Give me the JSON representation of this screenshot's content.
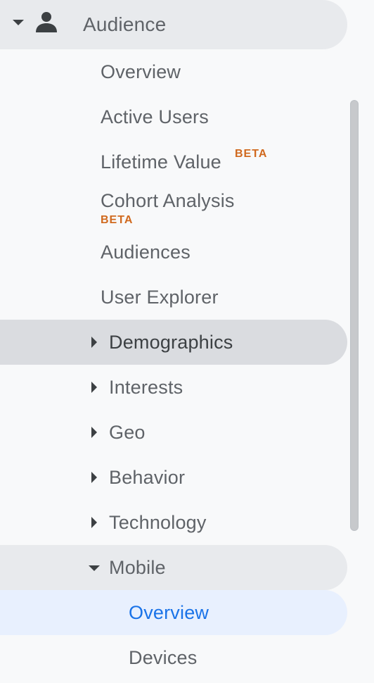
{
  "audience": {
    "label": "Audience",
    "icon": "person-icon"
  },
  "items": {
    "overview": "Overview",
    "active_users": "Active Users",
    "lifetime_value": "Lifetime Value",
    "lifetime_value_badge": "BETA",
    "cohort_analysis": "Cohort Analysis",
    "cohort_analysis_badge": "BETA",
    "audiences": "Audiences",
    "user_explorer": "User Explorer",
    "demographics": "Demographics",
    "interests": "Interests",
    "geo": "Geo",
    "behavior": "Behavior",
    "technology": "Technology",
    "mobile": "Mobile"
  },
  "mobile_items": {
    "overview": "Overview",
    "devices": "Devices"
  },
  "colors": {
    "background": "#f8f9fa",
    "text": "#5f6368",
    "text_dark": "#3c4043",
    "beta": "#d0691e",
    "selected_text": "#1a73e8",
    "selected_bg": "#e8f0fe",
    "hover_bg": "#dadce0",
    "expanded_bg": "#e8eaed"
  }
}
